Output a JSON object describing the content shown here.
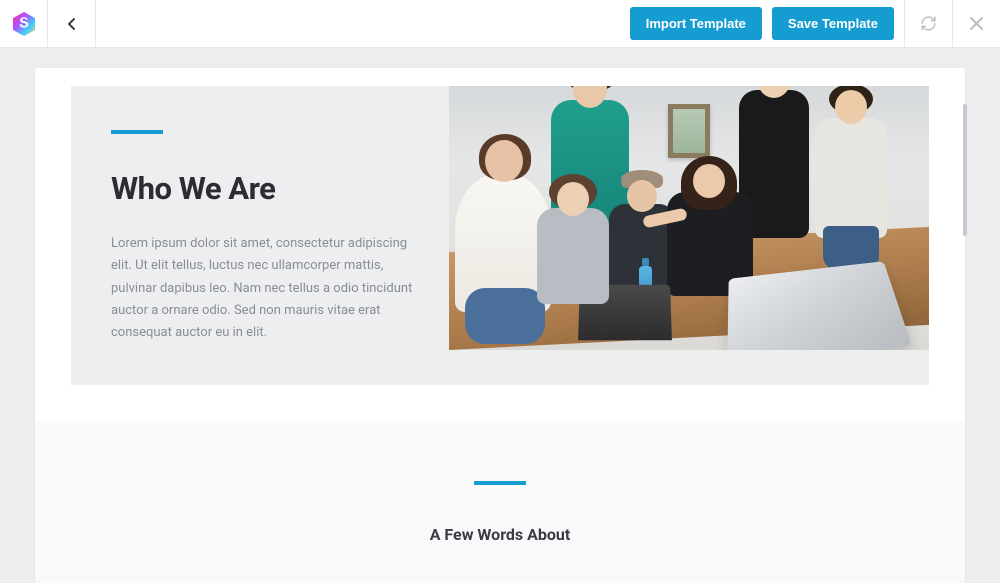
{
  "topbar": {
    "import_label": "Import Template",
    "save_label": "Save Template"
  },
  "hero": {
    "title": "Who We Are",
    "body": "Lorem ipsum dolor sit amet, consectetur adipiscing elit. Ut elit tellus, luctus nec ullamcorper mattis, pulvinar dapibus leo. Nam nec tellus a odio tincidunt auctor a ornare odio. Sed non mauris vitae erat consequat auctor eu in elit."
  },
  "section2": {
    "title": "A Few Words About"
  }
}
